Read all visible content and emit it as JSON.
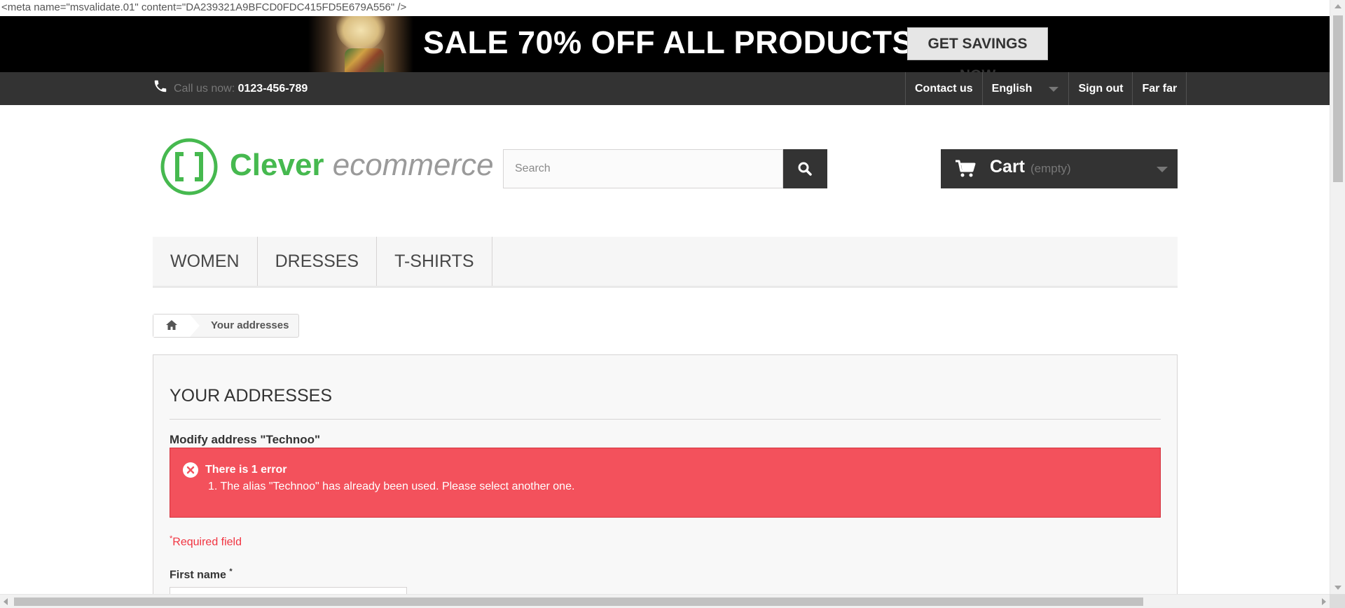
{
  "meta_line": "<meta name=\"msvalidate.01\" content=\"DA239321A9BFCD0FDC415FD5E679A556\" />",
  "banner": {
    "headline": "SALE 70% OFF ALL PRODUCTS",
    "cta_label": "GET SAVINGS NOW"
  },
  "topbar": {
    "phone_label": "Call us now:",
    "phone_number": "0123-456-789",
    "links": {
      "contact": "Contact us",
      "language": "English",
      "signout": "Sign out",
      "account": "Far far"
    }
  },
  "header": {
    "logo_word1": "Clever",
    "logo_word2": "ecommerce",
    "search_placeholder": "Search",
    "cart_label": "Cart",
    "cart_status": "(empty)"
  },
  "menu": {
    "items": [
      "WOMEN",
      "DRESSES",
      "T-SHIRTS"
    ]
  },
  "breadcrumb": {
    "current": "Your addresses"
  },
  "content": {
    "page_title": "YOUR ADDRESSES",
    "modify_title": "Modify address \"Technoo\"",
    "alert": {
      "title": "There is 1 error",
      "errors": [
        "1. The alias \"Technoo\" has already been used. Please select another one."
      ]
    },
    "required_mark": "*",
    "required_note": "Required field",
    "first_name_label": "First name",
    "first_name_value": ""
  },
  "colors": {
    "accent_green": "#46b94f",
    "error_red": "#f3515c",
    "dark_bar": "#333333"
  },
  "icons": {
    "phone": "phone-icon",
    "search": "search-icon",
    "cart": "cart-icon",
    "home": "home-icon",
    "error": "close-circle-icon"
  }
}
